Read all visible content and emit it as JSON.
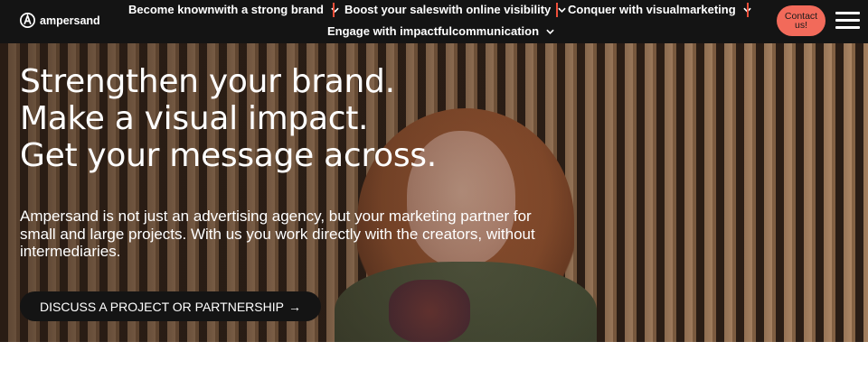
{
  "header": {
    "logo_text": "ampersand",
    "nav": [
      {
        "label": "Become knownwith a strong brand",
        "icon": "chevron-down-icon"
      },
      {
        "label": "Boost your saleswith online visibility",
        "icon": "chevron-down-icon"
      },
      {
        "label": "Conquer with visualmarketing",
        "icon": "chevron-down-icon"
      },
      {
        "label": "Engage with impactfulcommunication",
        "icon": "chevron-down-icon"
      }
    ],
    "contact_label_line1": "Contact",
    "contact_label_line2": "us!",
    "menu_icon": "hamburger-menu-icon"
  },
  "hero": {
    "headline": [
      "Strengthen your brand.",
      "Make a visual impact.",
      "Get your message across."
    ],
    "lede": "Ampersand is not just an advertising agency, but your marketing partner for small and large projects. With us you work directly with the creators, without intermediaries.",
    "cta_label": "DISCUSS A PROJECT OR PARTNERSHIP",
    "cta_arrow": "→"
  },
  "colors": {
    "header_bg": "#141414",
    "accent": "#f26a5a",
    "separator": "#ef4f3a",
    "text": "#ffffff"
  }
}
